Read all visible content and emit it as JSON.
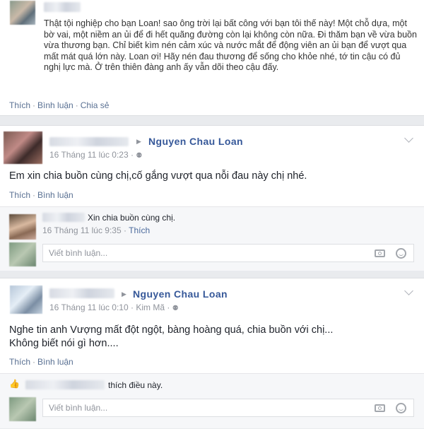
{
  "post1": {
    "text": "Thật tội nghiệp cho bạn Loan! sao ông trời lại bất công với bạn tôi thế này! Một chỗ dựa, một bờ vai, một niềm an ủi để đi hết quãng đường còn lại không còn nữa. Đi thăm bạn về vừa buồn vừa thương bạn. Chỉ biết kìm nén cảm xúc và nước mắt để động viên an ủi bạn để vượt qua mất mát quá lớn này. Loan ơi! Hãy nén đau thương để sống cho khỏe nhé, tớ tin cậu có đủ nghị lực mà. Ở trên thiên đàng anh ấy vẫn dõi theo cậu đấy.",
    "like_label": "Thích",
    "comment_label": "Bình luận",
    "share_label": "Chia sẻ"
  },
  "post2": {
    "target": "Nguyen Chau Loan",
    "timestamp": "16 Tháng 11 lúc 0:23",
    "text": "Em xin chia buồn cùng chị,cố gắng vượt qua nỗi đau này chị nhé.",
    "like_label": "Thích",
    "comment_label": "Bình luận",
    "reply": {
      "text": "Xin chia buồn cùng chị.",
      "timestamp": "16 Tháng 11 lúc 9:35",
      "like_label": "Thích"
    },
    "comment_placeholder": "Viết bình luận..."
  },
  "post3": {
    "target": "Nguyen Chau Loan",
    "timestamp": "16 Tháng 11 lúc 0:10",
    "location": "Kim Mã",
    "text_line1": "Nghe tin anh Vượng mất đột ngột, bàng hoàng quá, chia buồn với chị...",
    "text_line2": "Không biết nói gì hơn....",
    "like_label": "Thích",
    "comment_label": "Bình luận",
    "likes_text": "thích điều này.",
    "comment_placeholder": "Viết bình luận..."
  },
  "separator": "·",
  "icons": [
    "audience-friends-icon",
    "chevron-down-icon",
    "camera-icon",
    "emoji-icon",
    "thumbs-up-icon"
  ]
}
